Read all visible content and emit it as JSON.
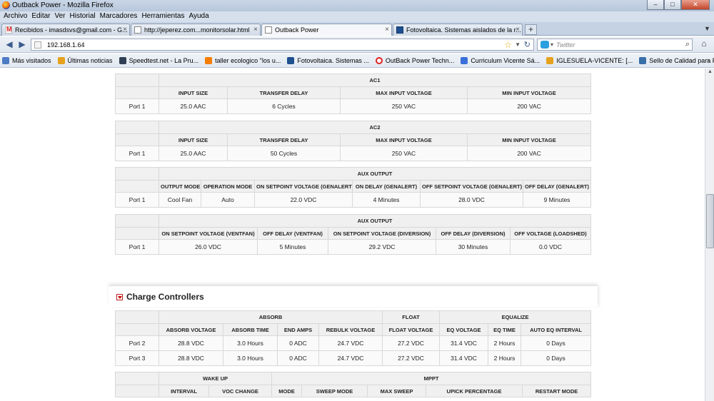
{
  "window": {
    "title": "Outback Power - Mozilla Firefox",
    "buttons": [
      "–",
      "□",
      "✕"
    ]
  },
  "menu": [
    "Archivo",
    "Editar",
    "Ver",
    "Historial",
    "Marcadores",
    "Herramientas",
    "Ayuda"
  ],
  "tabs": [
    {
      "label": "Recibidos - imasdsvs@gmail.com - G...",
      "icon": "gmail-icon"
    },
    {
      "label": "http://jeperez.com...monitorsolar.html",
      "icon": "page-icon"
    },
    {
      "label": "Outback Power",
      "icon": "page-icon",
      "active": true
    },
    {
      "label": "Fotovoltaica. Sistemas aislados de la r...",
      "icon": "foto-icon"
    }
  ],
  "nav": {
    "url": "192.168.1.64",
    "search_placeholder": "Twitter"
  },
  "bookmarks": [
    {
      "label": "Más visitados",
      "icon": "star-folder-icon",
      "color": "#4d7bc4"
    },
    {
      "label": "Últimas noticias",
      "icon": "rss-icon",
      "color": "#e5a21d"
    },
    {
      "label": "Speedtest.net - La Pru...",
      "icon": "speedtest-icon",
      "color": "#2f3f55"
    },
    {
      "label": "taller ecologico \"los u...",
      "icon": "blogger-icon",
      "color": "#f57d00"
    },
    {
      "label": "Fotovoltaica. Sistemas ...",
      "icon": "foto-icon",
      "color": "#1e4f8e"
    },
    {
      "label": "OutBack Power Techn...",
      "icon": "outback-icon",
      "color": "#d22"
    },
    {
      "label": "Curriculum Vicente Sá...",
      "icon": "doc-icon",
      "color": "#3a6fd8"
    },
    {
      "label": "IGLESUELA-VICENTE: [...",
      "icon": "rss-icon",
      "color": "#e5a21d"
    },
    {
      "label": "Sello de Calidad para P...",
      "icon": "seal-icon",
      "color": "#3a6fa8"
    }
  ],
  "ac1": {
    "title": "AC1",
    "headers": [
      "INPUT SIZE",
      "TRANSFER DELAY",
      "MAX INPUT VOLTAGE",
      "MIN INPUT VOLTAGE"
    ],
    "rows": [
      [
        "Port 1",
        "25.0 AAC",
        "6 Cycles",
        "250 VAC",
        "200 VAC"
      ]
    ]
  },
  "ac2": {
    "title": "AC2",
    "headers": [
      "INPUT SIZE",
      "TRANSFER DELAY",
      "MAX INPUT VOLTAGE",
      "MIN INPUT VOLTAGE"
    ],
    "rows": [
      [
        "Port 1",
        "25.0 AAC",
        "50 Cycles",
        "250 VAC",
        "200 VAC"
      ]
    ]
  },
  "aux1": {
    "title": "AUX OUTPUT",
    "headers": [
      "OUTPUT MODE",
      "OPERATION MODE",
      "ON SETPOINT VOLTAGE (GENALERT)",
      "ON DELAY (GENALERT)",
      "OFF SETPOINT VOLTAGE (GENALERT)",
      "OFF DELAY (GENALERT)"
    ],
    "rows": [
      [
        "Port 1",
        "Cool Fan",
        "Auto",
        "22.0 VDC",
        "4 Minutes",
        "28.0 VDC",
        "9 Minutes"
      ]
    ]
  },
  "aux2": {
    "title": "AUX OUTPUT",
    "headers": [
      "ON SETPOINT VOLTAGE (VENTFAN)",
      "OFF DELAY (VENTFAN)",
      "ON SETPOINT VOLTAGE (DIVERSION)",
      "OFF DELAY (DIVERSION)",
      "OFF VOLTAGE (LOADSHED)"
    ],
    "rows": [
      [
        "Port 1",
        "26.0 VDC",
        "5 Minutes",
        "29.2 VDC",
        "30 Minutes",
        "0.0 VDC"
      ]
    ]
  },
  "charge_controllers": {
    "title": "Charge Controllers",
    "groups": [
      "ABSORB",
      "FLOAT",
      "EQUALIZE"
    ],
    "headers": [
      "ABSORB VOLTAGE",
      "ABSORB TIME",
      "END AMPS",
      "REBULK VOLTAGE",
      "FLOAT VOLTAGE",
      "EQ VOLTAGE",
      "EQ TIME",
      "AUTO EQ INTERVAL"
    ],
    "rows": [
      [
        "Port 2",
        "28.8 VDC",
        "3.0 Hours",
        "0 ADC",
        "24.7 VDC",
        "27.2 VDC",
        "31.4 VDC",
        "2 Hours",
        "0 Days"
      ],
      [
        "Port 3",
        "28.8 VDC",
        "3.0 Hours",
        "0 ADC",
        "24.7 VDC",
        "27.2 VDC",
        "31.4 VDC",
        "2 Hours",
        "0 Days"
      ]
    ]
  },
  "wakeup_mppt": {
    "groups": [
      "WAKE UP",
      "MPPT"
    ],
    "headers": [
      "INTERVAL",
      "VOC CHANGE",
      "MODE",
      "SWEEP MODE",
      "MAX SWEEP",
      "UPICK PERCENTAGE",
      "RESTART MODE"
    ]
  }
}
